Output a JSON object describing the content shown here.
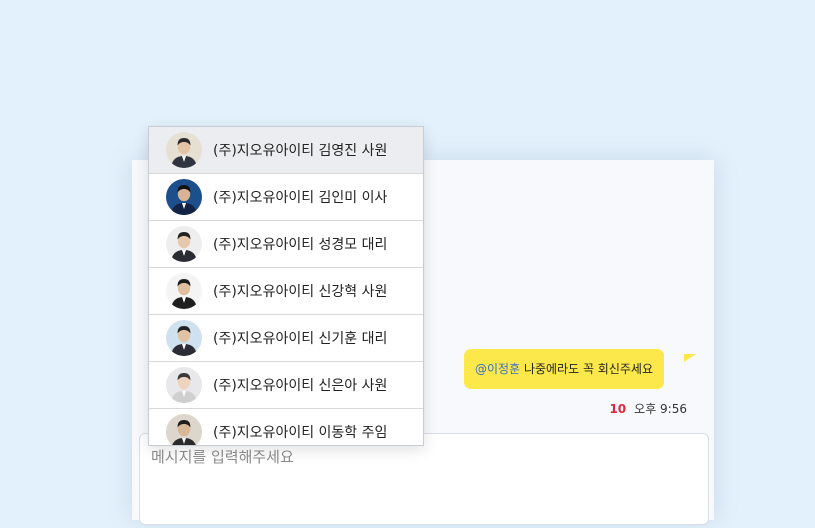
{
  "mention_list": {
    "items": [
      {
        "name": "(주)지오유아이티 김영진 사원",
        "avatar_bg": "#e6e0d2",
        "shirt": "#2e3440",
        "hair": "#2a2a2a",
        "skin": "#e4c4a6",
        "active": true
      },
      {
        "name": "(주)지오유아이티 김인미 이사",
        "avatar_bg": "#1d4f8c",
        "shirt": "#112244",
        "hair": "#111111",
        "skin": "#d8b494",
        "active": false
      },
      {
        "name": "(주)지오유아이티 성경모 대리",
        "avatar_bg": "#eeeeee",
        "shirt": "#2b2b33",
        "hair": "#222222",
        "skin": "#e6c8ad",
        "active": false
      },
      {
        "name": "(주)지오유아이티 신강혁 사원",
        "avatar_bg": "#f4f4f4",
        "shirt": "#1e1e1e",
        "hair": "#1c1c1c",
        "skin": "#dfbf9f",
        "active": false
      },
      {
        "name": "(주)지오유아이티 신기훈 대리",
        "avatar_bg": "#cfe1ee",
        "shirt": "#2c2c36",
        "hair": "#222222",
        "skin": "#e2c2a4",
        "active": false
      },
      {
        "name": "(주)지오유아이티 신은아 사원",
        "avatar_bg": "#e8e8ea",
        "shirt": "#cfcfcf",
        "hair": "#3a3a3a",
        "skin": "#eed3bd",
        "active": false
      },
      {
        "name": "(주)지오유아이티 이동학 주임",
        "avatar_bg": "#dcd6cc",
        "shirt": "#2a2a2a",
        "hair": "#1e1e1e",
        "skin": "#d9b896",
        "active": false
      }
    ]
  },
  "message": {
    "mention": "@이정훈",
    "text": " 나중에라도 꼭 회신주세요",
    "unread_count": "10",
    "time": "오후 9:56",
    "bubble_color": "#fce84b"
  },
  "input": {
    "placeholder": "메시지를 입력해주세요"
  }
}
